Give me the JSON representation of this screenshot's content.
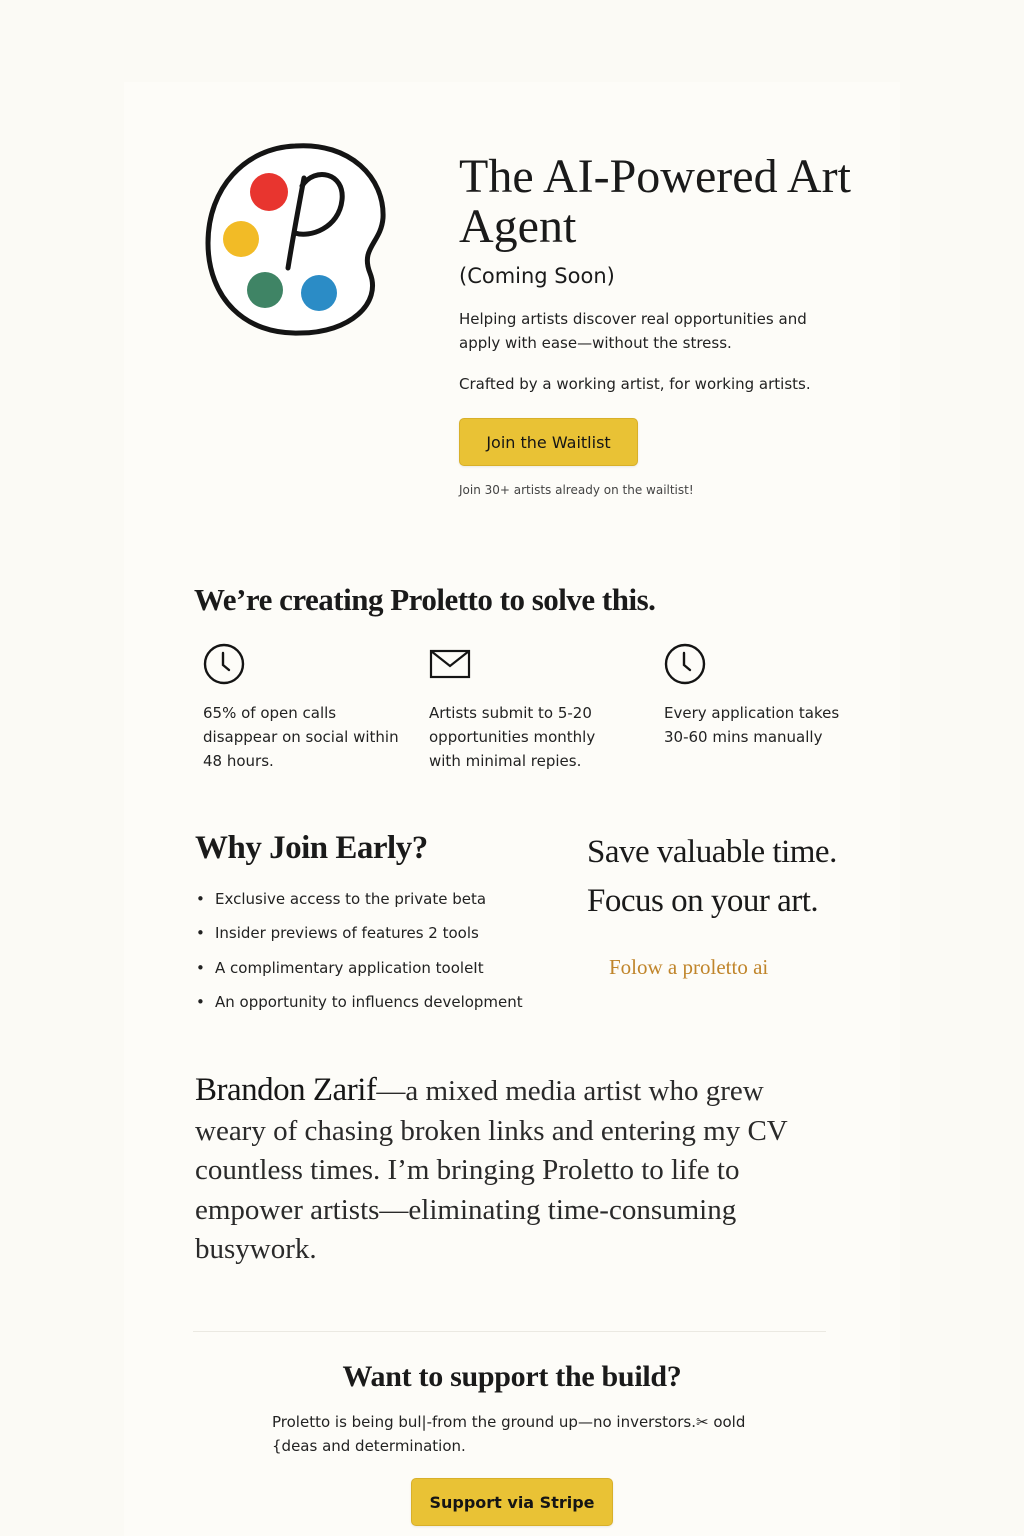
{
  "hero": {
    "title": "The AI-Powered Art Agent",
    "subtitle": "(Coming Soon)",
    "description": "Helping artists discover real opportunities and apply with ease—without the stress.",
    "crafted": "Crafted by a working artist, for working artists.",
    "cta_label": "Join the Waitlist",
    "waitlist_note": "Join 30+ artists already on the wailtist!"
  },
  "logo": {
    "letter": "P",
    "dot_colors": [
      "#e8352f",
      "#f2bb26",
      "#3f8465",
      "#2b8cc6"
    ]
  },
  "problems": {
    "heading": "We’re creating Proletto to solve this.",
    "items": [
      {
        "icon": "clock-icon",
        "text": "65% of open calls disappear on social within 48 hours."
      },
      {
        "icon": "envelope-icon",
        "text": "Artists submit to 5-20 opportunities monthly with minimal repies."
      },
      {
        "icon": "clock-icon",
        "text": "Every application takes 30-60 mins manually"
      }
    ]
  },
  "why_join": {
    "heading": "Why Join Early?",
    "items": [
      "Exclusive access to the private beta",
      "Insider previews of features 2 tools",
      "A complimentary application tooleIt",
      "An opportunity to influencs development"
    ]
  },
  "value": {
    "line1": "Save valuable time.",
    "line2": "Focus on your art.",
    "follow_label": "Folow a proletto ai"
  },
  "founder": {
    "name": "Brandon Zarif",
    "bio": "—a mixed media artist who grew weary of chasing broken links and entering my CV countless times. I’m bringing Proletto to life to empower artists—eliminating time-consuming busywork."
  },
  "support": {
    "heading": "Want to support the build?",
    "text": "Proletto is being bul|-from the ground up—no inverstors.✂ oold {deas and determination.",
    "cta_label": "Support via Stripe"
  },
  "colors": {
    "accent": "#e9c235",
    "link": "#c0852b",
    "background": "#fbfaf5"
  }
}
